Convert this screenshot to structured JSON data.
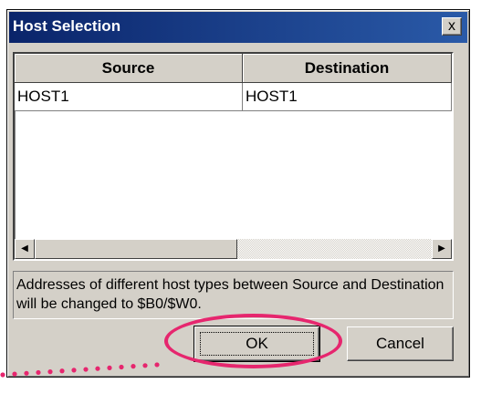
{
  "window": {
    "title": "Host Selection",
    "close_glyph": "x"
  },
  "grid": {
    "columns": [
      "Source",
      "Destination"
    ],
    "rows": [
      [
        "HOST1",
        "HOST1"
      ]
    ]
  },
  "scrollbar": {
    "left_arrow": "◀",
    "right_arrow": "▶"
  },
  "note": "Addresses of different host types between Source and Destination will be changed to $B0/$W0.",
  "buttons": {
    "ok": "OK",
    "cancel": "Cancel"
  },
  "callout": {
    "color": "#e6266e"
  }
}
